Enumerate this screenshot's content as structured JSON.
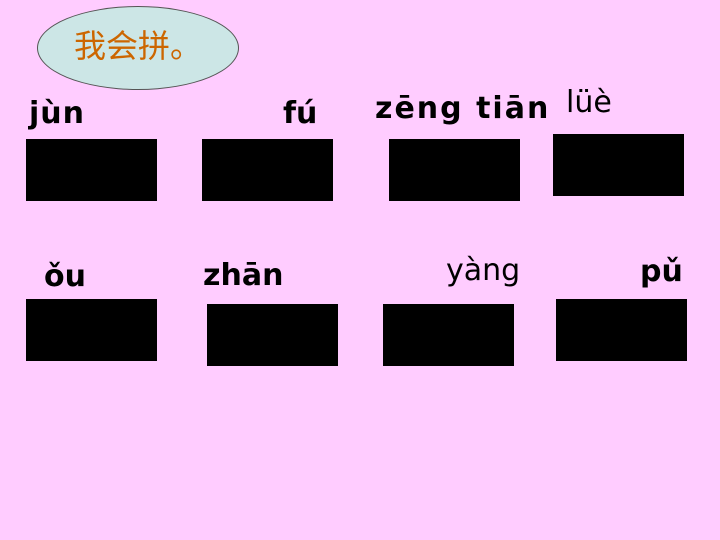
{
  "title": "我会拼。",
  "pinyin": {
    "jun": "jùn",
    "fu": "fú",
    "zeng_tian": "zēng tiān",
    "lue": "lüè",
    "ou": "ǒu",
    "zhan": "zhān",
    "yang": "yàng",
    "pu": "pǔ"
  }
}
